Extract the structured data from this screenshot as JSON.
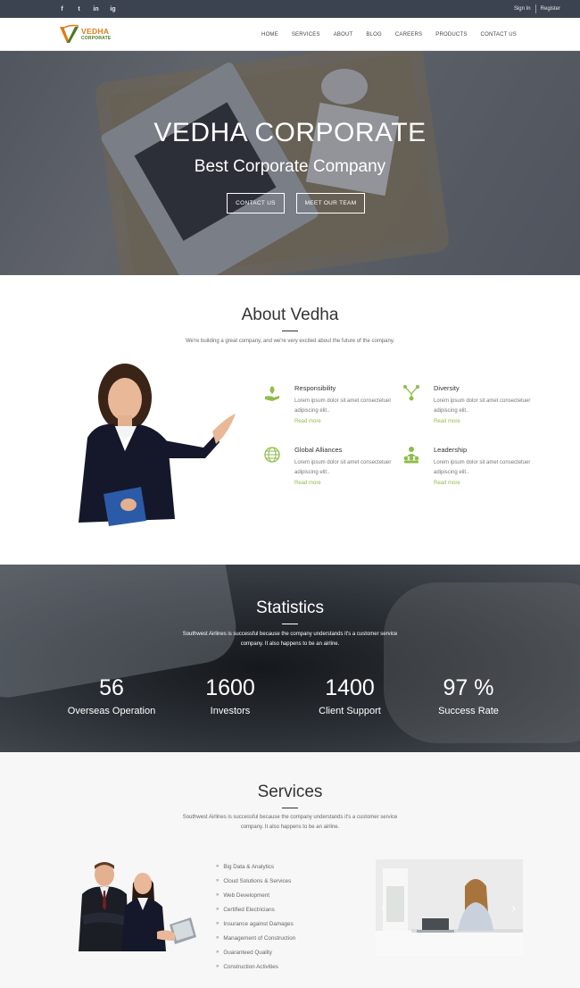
{
  "topbar": {
    "social": [
      "f",
      "t",
      "in",
      "ig"
    ],
    "signin": "Sign In",
    "register": "Register"
  },
  "brand": {
    "name": "VEDHA",
    "tagline": "CORPORATE",
    "colors": {
      "orange": "#e07a18",
      "green": "#4a7a20"
    }
  },
  "nav": {
    "items": [
      "HOME",
      "SERVICES",
      "ABOUT",
      "BLOG",
      "CAREERS",
      "PRODUCTS",
      "CONTACT US"
    ]
  },
  "hero": {
    "title": "VEDHA CORPORATE",
    "subtitle": "Best Corporate Company",
    "buttons": [
      "CONTACT US",
      "MEET OUR TEAM"
    ]
  },
  "about": {
    "title": "About Vedha",
    "description": "We're building a great company, and we're very excited about the future of the company.",
    "features": [
      {
        "title": "Responsibility",
        "text": "Lorem ipsum dolor sit amet consectetuer adipiscing elit..",
        "link": "Read more",
        "icon": "hand-leaf-icon"
      },
      {
        "title": "Diversity",
        "text": "Lorem ipsum dolor sit amet consectetuer adipiscing elit..",
        "link": "Read more",
        "icon": "network-icon"
      },
      {
        "title": "Global Alliances",
        "text": "Lorem ipsum dolor sit amet consectetuer adipiscing elit..",
        "link": "Read more",
        "icon": "globe-icon"
      },
      {
        "title": "Leadership",
        "text": "Lorem ipsum dolor sit amet consectetuer adipiscing elit..",
        "link": "Read more",
        "icon": "team-icon"
      }
    ],
    "accent": "#8fbd4a"
  },
  "statistics": {
    "title": "Statistics",
    "description": "Southwest Airlines is successful because the company understands it's a customer service company. It also happens to be an airline.",
    "items": [
      {
        "value": "56",
        "label": "Overseas Operation"
      },
      {
        "value": "1600",
        "label": "Investors"
      },
      {
        "value": "1400",
        "label": "Client Support"
      },
      {
        "value": "97 %",
        "label": "Success Rate"
      }
    ]
  },
  "services": {
    "title": "Services",
    "description": "Southwest Airlines is successful because the company understands it's a customer service company. It also happens to be an airline.",
    "list": [
      "Big Data & Analytics",
      "Cloud Solutions & Services",
      "Web Development",
      "Certified Electricians",
      "Insurance against Damages",
      "Management of Construction",
      "Guaranteed Quality",
      "Construction Activities"
    ]
  }
}
